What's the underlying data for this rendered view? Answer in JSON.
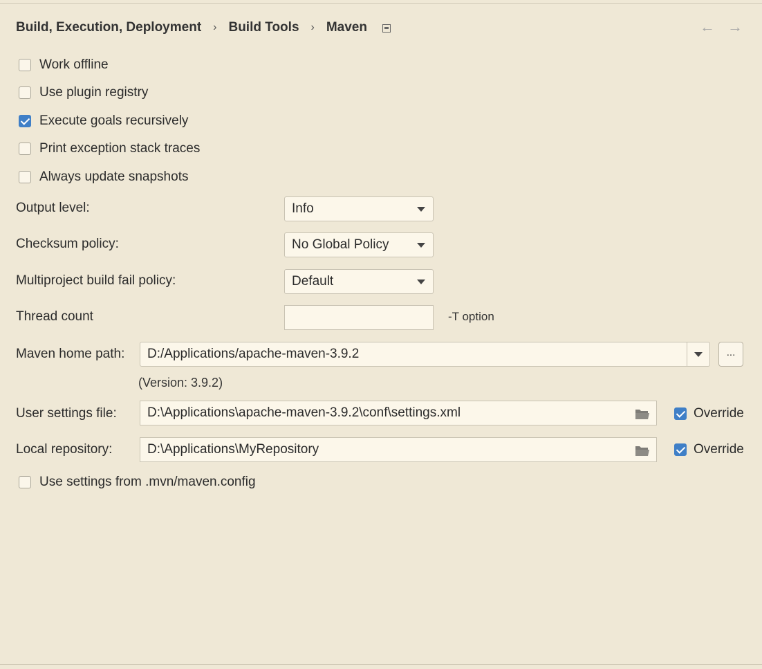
{
  "breadcrumb": {
    "items": [
      "Build, Execution, Deployment",
      "Build Tools",
      "Maven"
    ],
    "separator": "›",
    "icons": [
      "window-icon"
    ]
  },
  "nav": {
    "back": "←",
    "forward": "→"
  },
  "options": {
    "work_offline": {
      "label": "Work offline",
      "checked": false
    },
    "use_plugin_registry": {
      "label": "Use plugin registry",
      "checked": false
    },
    "execute_goals_recursively": {
      "label": "Execute goals recursively",
      "checked": true
    },
    "print_exception_stack_traces": {
      "label": "Print exception stack traces",
      "checked": false
    },
    "always_update_snapshots": {
      "label": "Always update snapshots",
      "checked": false
    }
  },
  "output_level": {
    "label": "Output level:",
    "value": "Info"
  },
  "checksum_policy": {
    "label": "Checksum policy:",
    "value": "No Global Policy"
  },
  "multiproject_fail_policy": {
    "label": "Multiproject build fail policy:",
    "value": "Default"
  },
  "thread_count": {
    "label": "Thread count",
    "value": "",
    "hint": "-T option"
  },
  "maven_home": {
    "label": "Maven home path:",
    "value": "D:/Applications/apache-maven-3.9.2",
    "browse_label": "...",
    "version": "(Version: 3.9.2)"
  },
  "user_settings": {
    "label": "User settings file:",
    "value": "D:\\Applications\\apache-maven-3.9.2\\conf\\settings.xml",
    "override_label": "Override",
    "override_checked": true
  },
  "local_repository": {
    "label": "Local repository:",
    "value": "D:\\Applications\\MyRepository",
    "override_label": "Override",
    "override_checked": true
  },
  "use_mvn_config": {
    "label": "Use settings from .mvn/maven.config",
    "checked": false
  },
  "colors": {
    "background": "#efe8d6",
    "field_background": "#fcf7ea",
    "checkbox_checked": "#3f7fc7"
  }
}
